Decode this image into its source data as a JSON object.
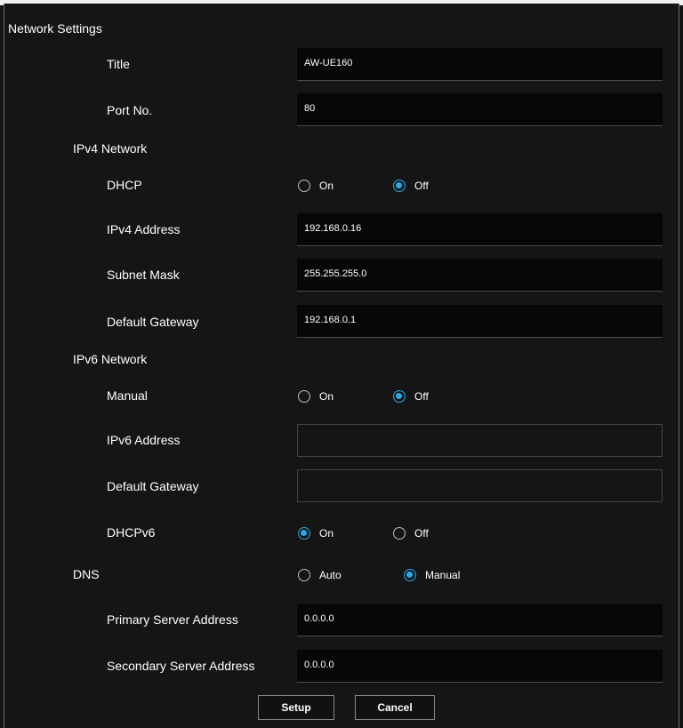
{
  "page_title": "Network Settings",
  "title": {
    "label": "Title",
    "value": "AW-UE160"
  },
  "port": {
    "label": "Port No.",
    "value": "80"
  },
  "ipv4": {
    "section": "IPv4 Network",
    "dhcp": {
      "label": "DHCP",
      "on": "On",
      "off": "Off",
      "selected": "Off"
    },
    "address": {
      "label": "IPv4 Address",
      "value": "192.168.0.16"
    },
    "subnet": {
      "label": "Subnet Mask",
      "value": "255.255.255.0"
    },
    "gateway": {
      "label": "Default Gateway",
      "value": "192.168.0.1"
    }
  },
  "ipv6": {
    "section": "IPv6 Network",
    "manual": {
      "label": "Manual",
      "on": "On",
      "off": "Off",
      "selected": "Off"
    },
    "address": {
      "label": "IPv6 Address",
      "value": ""
    },
    "gateway": {
      "label": "Default Gateway",
      "value": ""
    },
    "dhcpv6": {
      "label": "DHCPv6",
      "on": "On",
      "off": "Off",
      "selected": "On"
    }
  },
  "dns": {
    "section": "DNS",
    "auto": "Auto",
    "manual": "Manual",
    "selected": "Manual",
    "primary": {
      "label": "Primary Server Address",
      "value": "0.0.0.0"
    },
    "secondary": {
      "label": "Secondary Server Address",
      "value": "0.0.0.0"
    }
  },
  "buttons": {
    "setup": "Setup",
    "cancel": "Cancel"
  },
  "colors": {
    "accent": "#2aa9e8",
    "background": "#151515",
    "field": "#070707"
  }
}
